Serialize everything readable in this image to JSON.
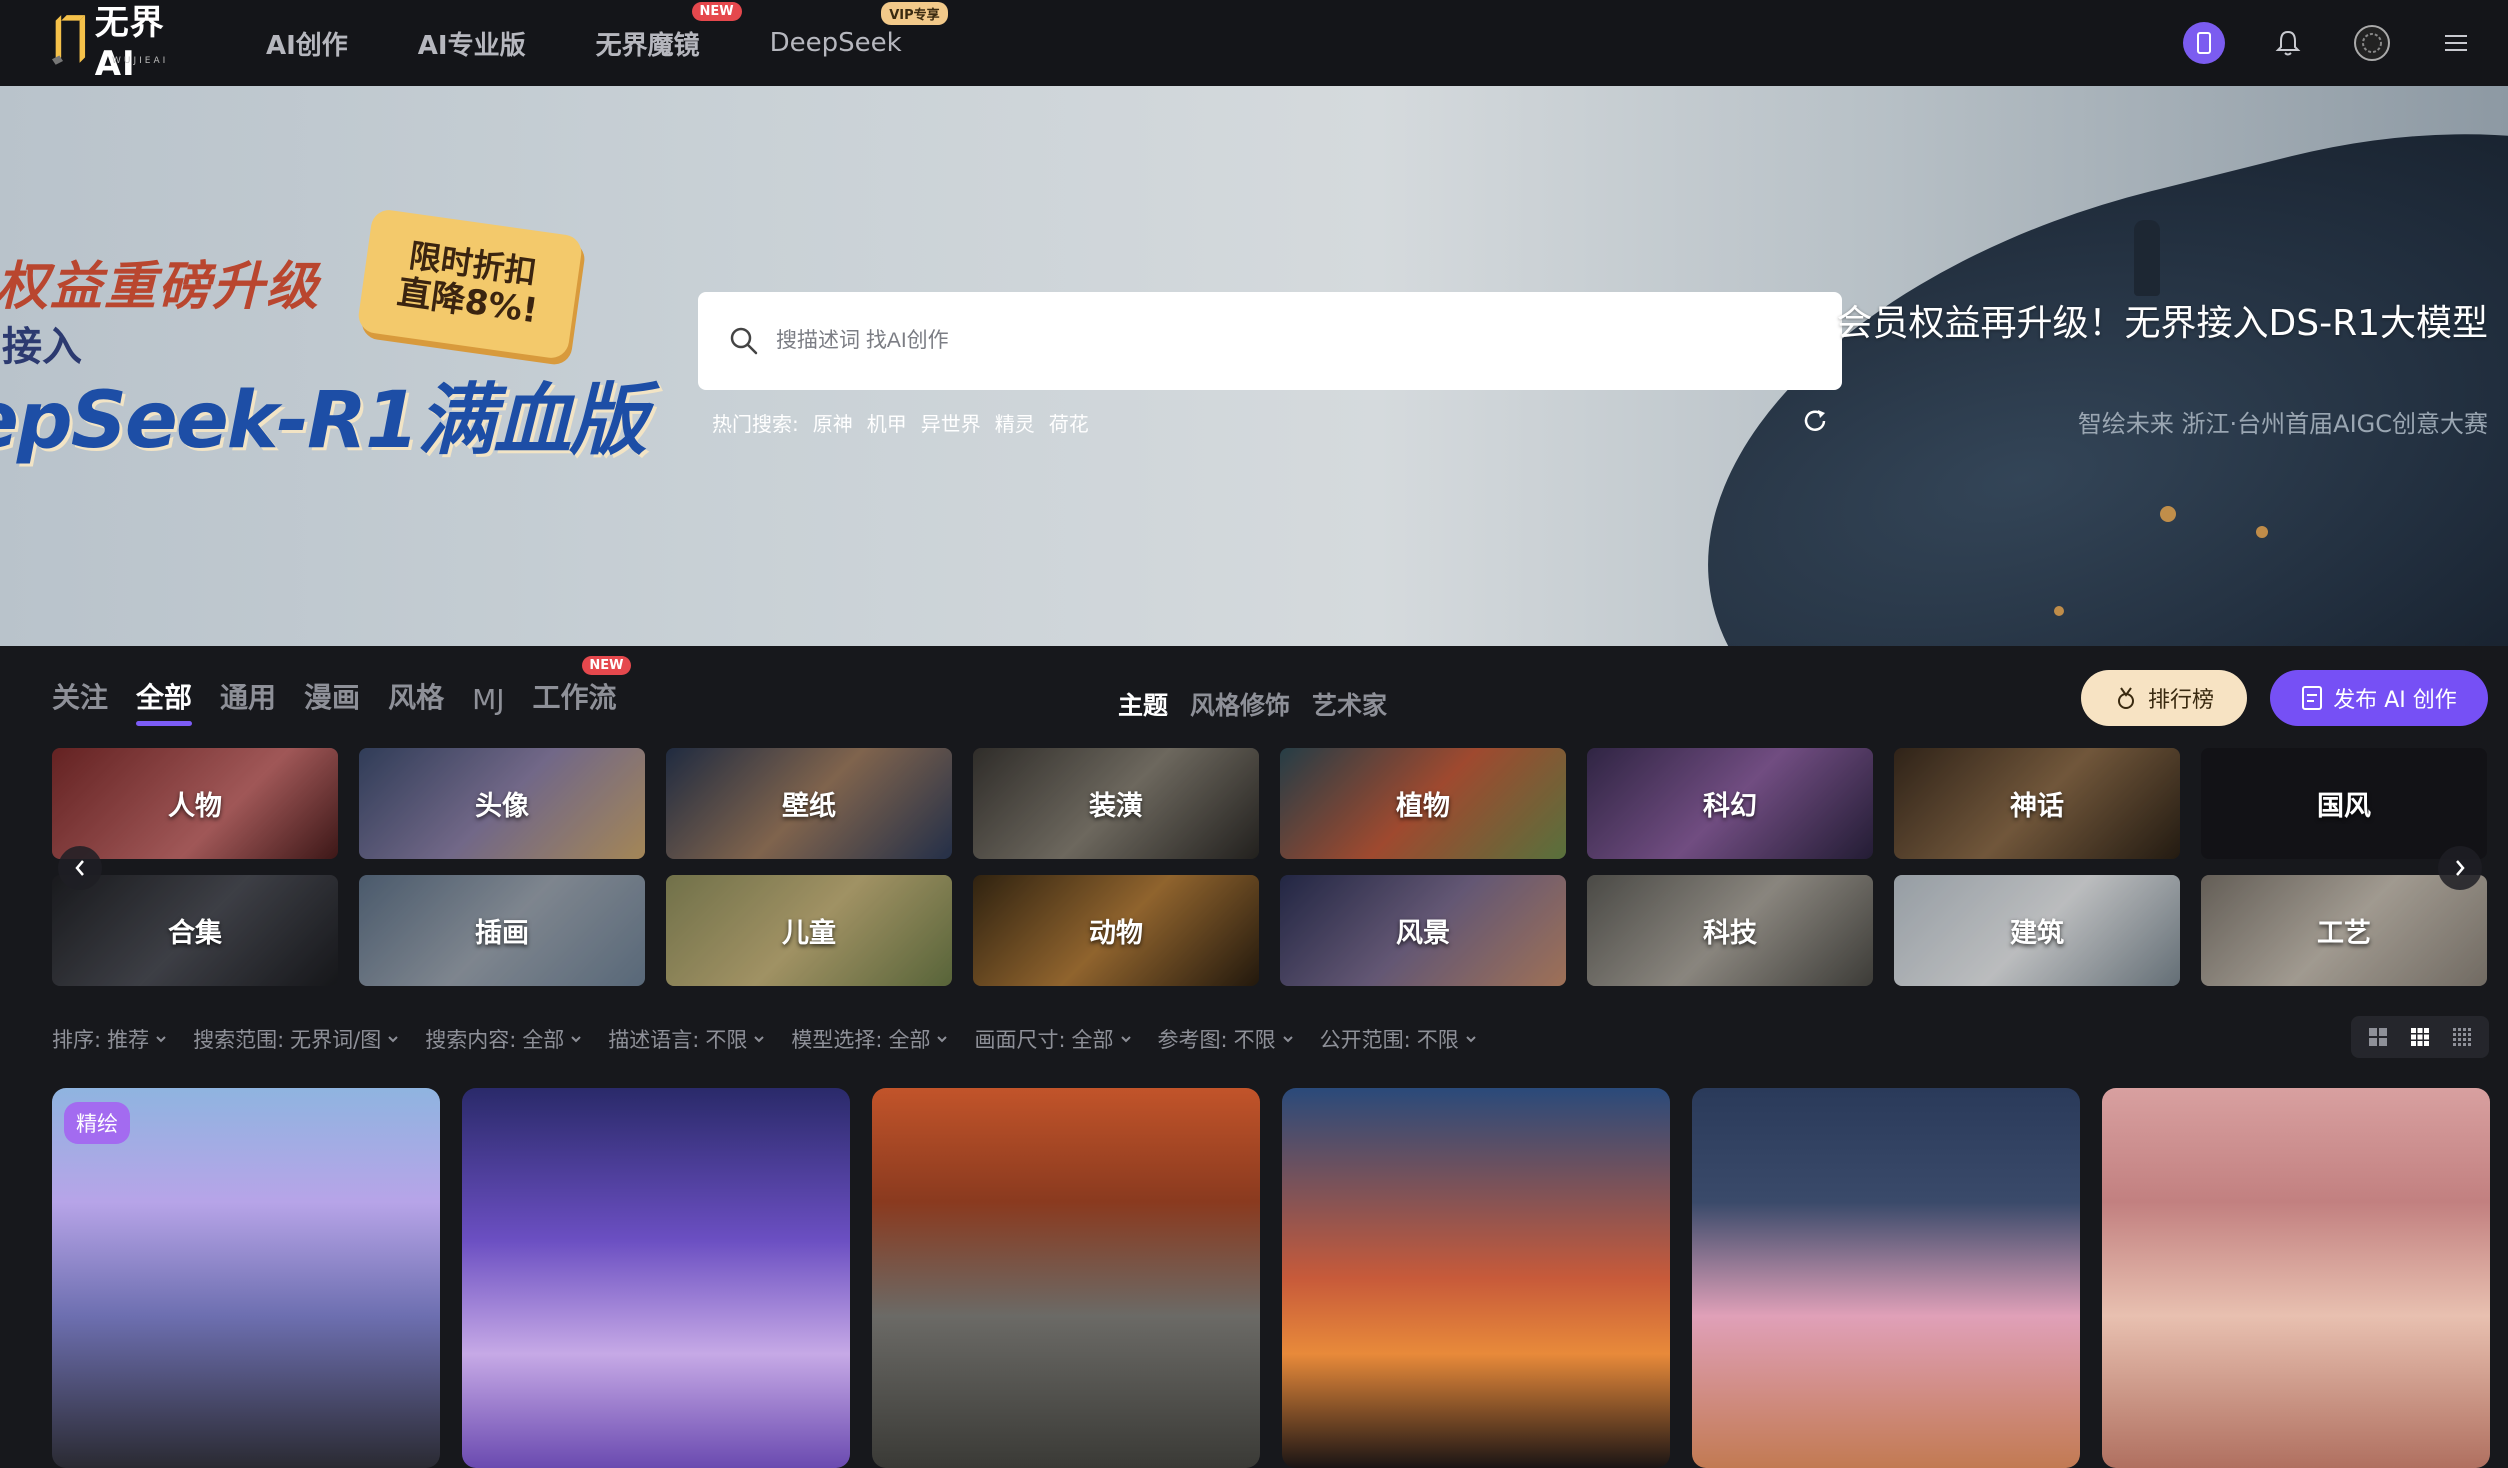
{
  "header": {
    "logo_text": "无界AI",
    "logo_sub": "WUJIEAI",
    "nav": [
      {
        "label": "AI创作",
        "badge": ""
      },
      {
        "label": "AI专业版",
        "badge": ""
      },
      {
        "label": "无界魔镜",
        "badge": "NEW"
      },
      {
        "label": "DeepSeek",
        "badge": "VIP专享"
      }
    ]
  },
  "hero": {
    "promo_line1": "权益重磅升级",
    "promo_line2": "接入",
    "promo_line3": "epSeek-R1满血版",
    "promo_tag_line1": "限时折扣",
    "promo_tag_line2": "直降8%!",
    "search_placeholder": "搜描述词 找AI创作",
    "hot_label": "热门搜索:",
    "hot_terms": [
      "原神",
      "机甲",
      "异世界",
      "精灵",
      "荷花"
    ],
    "title": "会员权益再升级！无界接入DS-R1大模型",
    "subtitle": "智绘未来 浙江·台州首届AIGC创意大赛"
  },
  "tabs": {
    "main": [
      {
        "label": "关注",
        "active": false,
        "badge": ""
      },
      {
        "label": "全部",
        "active": true,
        "badge": ""
      },
      {
        "label": "通用",
        "active": false,
        "badge": ""
      },
      {
        "label": "漫画",
        "active": false,
        "badge": ""
      },
      {
        "label": "风格",
        "active": false,
        "badge": ""
      },
      {
        "label": "MJ",
        "active": false,
        "badge": ""
      },
      {
        "label": "工作流",
        "active": false,
        "badge": "NEW"
      }
    ],
    "sub": [
      {
        "label": "主题",
        "active": true
      },
      {
        "label": "风格修饰",
        "active": false
      },
      {
        "label": "艺术家",
        "active": false
      }
    ],
    "rank_label": "排行榜",
    "publish_label": "发布 AI 创作"
  },
  "categories": [
    {
      "label": "人物",
      "bg": "linear-gradient(135deg,#7a2a2a,#c46b6b 60%,#4a1d1d)"
    },
    {
      "label": "头像",
      "bg": "linear-gradient(135deg,#3b4a6b,#8b7fa6 50%,#c8a46a)"
    },
    {
      "label": "壁纸",
      "bg": "linear-gradient(135deg,#27354f,#9c7a5e 50%,#2c3a58)"
    },
    {
      "label": "装潢",
      "bg": "linear-gradient(135deg,#3a3733,#857f73 50%,#2a2825)"
    },
    {
      "label": "植物",
      "bg": "linear-gradient(135deg,#2e4b56,#c25a3a 50%,#6b8a4a)"
    },
    {
      "label": "科幻",
      "bg": "linear-gradient(135deg,#3a2d52,#8a5e9e 50%,#2b2340)"
    },
    {
      "label": "神话",
      "bg": "linear-gradient(135deg,#3a2b1e,#8a6a48 50%,#2b2116)"
    },
    {
      "label": "国风",
      "bg": "#16171b"
    },
    {
      "label": "合集",
      "bg": "linear-gradient(135deg,#1f2024,#4b4d55 50%,#1b1c20)"
    },
    {
      "label": "插画",
      "bg": "linear-gradient(135deg,#5b6e84,#9aa3ae 50%,#6c7f93)"
    },
    {
      "label": "儿童",
      "bg": "linear-gradient(135deg,#8a8a5a,#c4b27a 50%,#6b7a46)"
    },
    {
      "label": "动物",
      "bg": "linear-gradient(135deg,#3a2a14,#b07a38 50%,#2a1e10)"
    },
    {
      "label": "风景",
      "bg": "linear-gradient(135deg,#2a2f52,#7a6b8e 50%,#c28a6a)"
    },
    {
      "label": "科技",
      "bg": "linear-gradient(135deg,#5b5a55,#a8a39a 50%,#4a4944)"
    },
    {
      "label": "建筑",
      "bg": "linear-gradient(135deg,#b7c0c8,#e4e6e8 50%,#7a8790)"
    },
    {
      "label": "工艺",
      "bg": "linear-gradient(135deg,#7a736a,#c4bcb0 50%,#8a8278)"
    }
  ],
  "filters": [
    {
      "label": "排序:",
      "value": "推荐"
    },
    {
      "label": "搜索范围:",
      "value": "无界词/图"
    },
    {
      "label": "搜索内容:",
      "value": "全部"
    },
    {
      "label": "描述语言:",
      "value": "不限"
    },
    {
      "label": "模型选择:",
      "value": "全部"
    },
    {
      "label": "画面尺寸:",
      "value": "全部"
    },
    {
      "label": "参考图:",
      "value": "不限"
    },
    {
      "label": "公开范围:",
      "value": "不限"
    }
  ],
  "gallery": [
    {
      "badge": "精绘",
      "bg": "linear-gradient(180deg,#8fb4e0 0%,#b7a4e8 30%,#6d6fb0 60%,#2a2a32 100%)"
    },
    {
      "badge": "",
      "bg": "linear-gradient(180deg,#2a2a6a 0%,#6b4fc2 40%,#c6a9e6 70%,#6a4ab0 100%)"
    },
    {
      "badge": "",
      "bg": "linear-gradient(180deg,#c2542a 0%,#8a3a1f 30%,#6b6a66 60%,#3a3a36 100%)"
    },
    {
      "badge": "",
      "bg": "linear-gradient(180deg,#2a4a7a 0%,#c75a3a 50%,#e88a3a 70%,#1a1414 100%)"
    },
    {
      "badge": "",
      "bg": "linear-gradient(180deg,#2a3a5a 0%,#3a4a6a 30%,#e0a0b8 60%,#c27a52 100%)"
    },
    {
      "badge": "",
      "bg": "linear-gradient(180deg,#d8a0a0 0%,#c28080 30%,#e8c0b0 60%,#b07060 100%)"
    }
  ],
  "colors": {
    "accent": "#7650f5",
    "badge_red": "#e5484d",
    "rank_bg": "#f7e3c3"
  }
}
